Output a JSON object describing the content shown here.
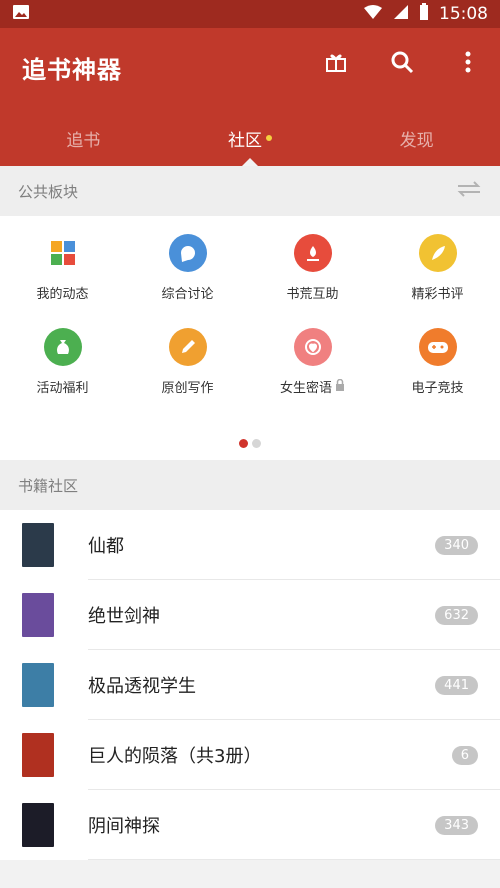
{
  "status_bar": {
    "time": "15:08"
  },
  "app": {
    "title": "追书神器",
    "tabs": [
      {
        "label": "追书"
      },
      {
        "label": "社区"
      },
      {
        "label": "发现"
      }
    ]
  },
  "public_section": {
    "title": "公共板块",
    "items": [
      {
        "label": "我的动态",
        "icon": "dynamic-icon",
        "color": "#f5a623"
      },
      {
        "label": "综合讨论",
        "icon": "chat-icon",
        "color": "#4a90d9"
      },
      {
        "label": "书荒互助",
        "icon": "help-icon",
        "color": "#e74c3c"
      },
      {
        "label": "精彩书评",
        "icon": "feather-icon",
        "color": "#f1c232"
      },
      {
        "label": "活动福利",
        "icon": "money-bag-icon",
        "color": "#4caf50"
      },
      {
        "label": "原创写作",
        "icon": "pencil-icon",
        "color": "#f0a030"
      },
      {
        "label": "女生密语",
        "icon": "heart-target-icon",
        "color": "#f08080"
      },
      {
        "label": "电子竞技",
        "icon": "gamepad-icon",
        "color": "#f07c2c"
      }
    ]
  },
  "book_section": {
    "title": "书籍社区",
    "items": [
      {
        "title": "仙都",
        "count": "340",
        "cover_color": "#2b3a4a"
      },
      {
        "title": "绝世剑神",
        "count": "632",
        "cover_color": "#6a4c9c"
      },
      {
        "title": "极品透视学生",
        "count": "441",
        "cover_color": "#3d7ea6"
      },
      {
        "title": "巨人的陨落（共3册）",
        "count": "6",
        "cover_color": "#b03020"
      },
      {
        "title": "阴间神探",
        "count": "343",
        "cover_color": "#1c1c28"
      }
    ]
  }
}
